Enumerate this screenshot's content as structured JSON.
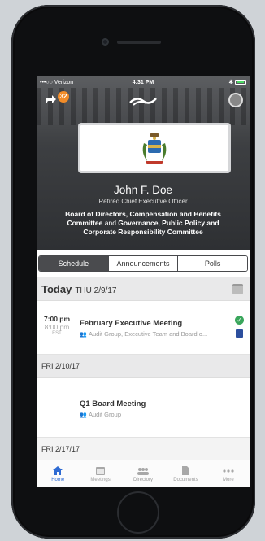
{
  "statusbar": {
    "carrier": "•••○○ Verizon",
    "time": "4:31 PM",
    "bluetooth": "✱"
  },
  "navbar": {
    "badge_count": "32"
  },
  "profile": {
    "name": "John F. Doe",
    "role": "Retired Chief Executive Officer",
    "committee_1": "Board of Directors, Compensation and Benefits",
    "committee_2a": "Committee",
    "committee_and": " and ",
    "committee_2b": "Governance, Public Policy and",
    "committee_3": "Corporate Responsibility Committee"
  },
  "tabs_segment": [
    {
      "label": "Schedule",
      "active": true
    },
    {
      "label": "Announcements",
      "active": false
    },
    {
      "label": "Polls",
      "active": false
    }
  ],
  "schedule": {
    "today_label": "Today",
    "today_date": "THU 2/9/17",
    "meeting1": {
      "start": "7:00 pm",
      "end": "8:00 pm",
      "tz": "EST",
      "title": "February Executive Meeting",
      "groups": "Audit Group, Executive Team and Board o..."
    },
    "day2": "FRI 2/10/17",
    "meeting2": {
      "title": "Q1 Board Meeting",
      "groups": "Audit Group"
    },
    "day3": "FRI 2/17/17"
  },
  "tabbar": {
    "items": [
      {
        "label": "Home",
        "icon": "home-icon",
        "active": true
      },
      {
        "label": "Meetings",
        "icon": "calendar-icon",
        "active": false
      },
      {
        "label": "Directory",
        "icon": "people-icon",
        "active": false
      },
      {
        "label": "Documents",
        "icon": "document-icon",
        "active": false
      },
      {
        "label": "More",
        "icon": "more-icon",
        "active": false
      }
    ]
  },
  "colors": {
    "accent": "#2f6bd3",
    "badge": "#f28c28",
    "check": "#3aa65c",
    "book": "#2c4f9e",
    "segment_active": "#4a4b4e"
  }
}
